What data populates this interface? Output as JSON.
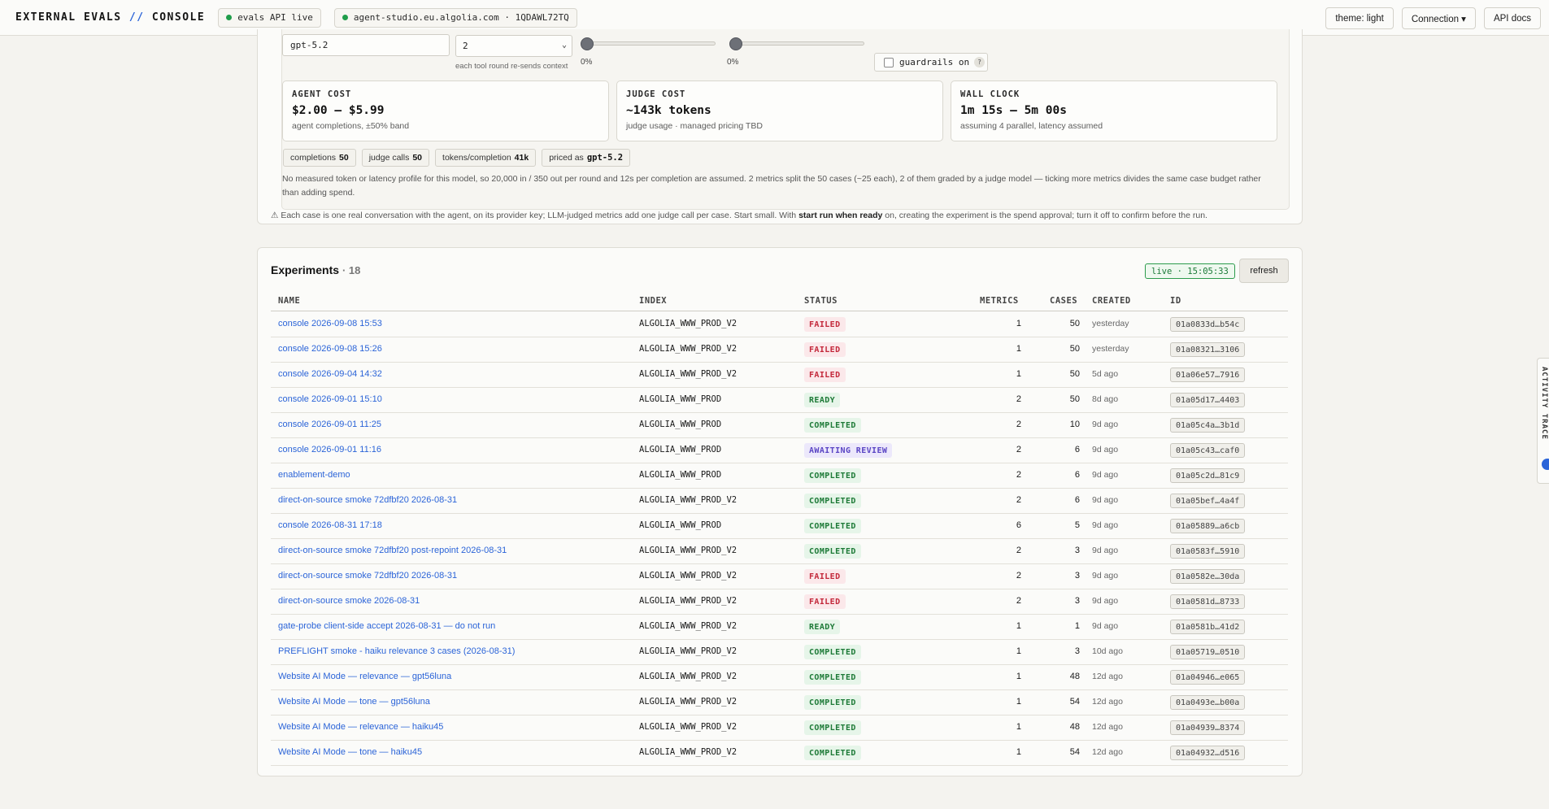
{
  "topbar": {
    "brand_main": "EXTERNAL EVALS",
    "brand_sep": "//",
    "brand_tail": "CONSOLE",
    "status_chip": "evals API live",
    "app_chip": "agent-studio.eu.algolia.com · 1QDAWL72TQ",
    "theme_button": "theme: light",
    "connection_button": "Connection ▾",
    "api_docs_button": "API docs",
    "status_color": "#1f9d4a"
  },
  "config": {
    "model_value": "gpt-5.2",
    "rounds_value": "2",
    "rounds_hint": "each tool round re-sends context",
    "slider1_pct": "0%",
    "slider1_value": 0,
    "slider2_pct": "0%",
    "slider2_value": 0,
    "guardrails_label": "guardrails on",
    "guardrails_help": "?",
    "guardrails_checked": false
  },
  "cards": [
    {
      "label": "AGENT COST",
      "value": "$2.00 – $5.99",
      "sub": "agent completions, ±50% band"
    },
    {
      "label": "JUDGE COST",
      "value": "~143k tokens",
      "sub": "judge usage · managed pricing TBD"
    },
    {
      "label": "WALL CLOCK",
      "value": "1m 15s – 5m 00s",
      "sub": "assuming 4 parallel, latency assumed"
    }
  ],
  "pills": [
    {
      "label": "completions",
      "value": "50"
    },
    {
      "label": "judge calls",
      "value": "50"
    },
    {
      "label": "tokens/completion",
      "value": "41k"
    },
    {
      "label": "priced as",
      "value": "gpt-5.2"
    }
  ],
  "note": "No measured token or latency profile for this model, so 20,000 in / 350 out per round and 12s per completion are assumed. 2 metrics split the 50 cases (~25 each), 2 of them graded by a judge model — ticking more metrics divides the same case budget rather than adding spend.",
  "warning": {
    "pre": "⚠ Each case is one real conversation with the agent, on its provider key; LLM-judged metrics add one judge call per case. Start small. With ",
    "bold": "start run when ready",
    "post": " on, creating the experiment is the spend approval; turn it off to confirm before the run."
  },
  "experiments": {
    "title": "Experiments",
    "count": "· 18",
    "live_label": "live · 15:05:33",
    "refresh_label": "refresh",
    "columns": {
      "name": "NAME",
      "index": "INDEX",
      "status": "STATUS",
      "metrics": "METRICS",
      "cases": "CASES",
      "created": "CREATED",
      "id": "ID"
    },
    "rows": [
      {
        "name": "console 2026-09-08 15:53",
        "index": "ALGOLIA_WWW_PROD_V2",
        "status": "FAILED",
        "kind": "failed",
        "metrics": "1",
        "cases": "50",
        "created": "yesterday",
        "id": "01a0833d…b54c"
      },
      {
        "name": "console 2026-09-08 15:26",
        "index": "ALGOLIA_WWW_PROD_V2",
        "status": "FAILED",
        "kind": "failed",
        "metrics": "1",
        "cases": "50",
        "created": "yesterday",
        "id": "01a08321…3106"
      },
      {
        "name": "console 2026-09-04 14:32",
        "index": "ALGOLIA_WWW_PROD_V2",
        "status": "FAILED",
        "kind": "failed",
        "metrics": "1",
        "cases": "50",
        "created": "5d ago",
        "id": "01a06e57…7916"
      },
      {
        "name": "console 2026-09-01 15:10",
        "index": "ALGOLIA_WWW_PROD",
        "status": "READY",
        "kind": "ready",
        "metrics": "2",
        "cases": "50",
        "created": "8d ago",
        "id": "01a05d17…4403"
      },
      {
        "name": "console 2026-09-01 11:25",
        "index": "ALGOLIA_WWW_PROD",
        "status": "COMPLETED",
        "kind": "completed",
        "metrics": "2",
        "cases": "10",
        "created": "9d ago",
        "id": "01a05c4a…3b1d"
      },
      {
        "name": "console 2026-09-01 11:16",
        "index": "ALGOLIA_WWW_PROD",
        "status": "AWAITING REVIEW",
        "kind": "awaiting",
        "metrics": "2",
        "cases": "6",
        "created": "9d ago",
        "id": "01a05c43…caf0"
      },
      {
        "name": "enablement-demo",
        "index": "ALGOLIA_WWW_PROD",
        "status": "COMPLETED",
        "kind": "completed",
        "metrics": "2",
        "cases": "6",
        "created": "9d ago",
        "id": "01a05c2d…81c9"
      },
      {
        "name": "direct-on-source smoke 72dfbf20 2026-08-31",
        "index": "ALGOLIA_WWW_PROD_V2",
        "status": "COMPLETED",
        "kind": "completed",
        "metrics": "2",
        "cases": "6",
        "created": "9d ago",
        "id": "01a05bef…4a4f"
      },
      {
        "name": "console 2026-08-31 17:18",
        "index": "ALGOLIA_WWW_PROD",
        "status": "COMPLETED",
        "kind": "completed",
        "metrics": "6",
        "cases": "5",
        "created": "9d ago",
        "id": "01a05889…a6cb"
      },
      {
        "name": "direct-on-source smoke 72dfbf20 post-repoint 2026-08-31",
        "index": "ALGOLIA_WWW_PROD_V2",
        "status": "COMPLETED",
        "kind": "completed",
        "metrics": "2",
        "cases": "3",
        "created": "9d ago",
        "id": "01a0583f…5910"
      },
      {
        "name": "direct-on-source smoke 72dfbf20 2026-08-31",
        "index": "ALGOLIA_WWW_PROD_V2",
        "status": "FAILED",
        "kind": "failed",
        "metrics": "2",
        "cases": "3",
        "created": "9d ago",
        "id": "01a0582e…30da"
      },
      {
        "name": "direct-on-source smoke 2026-08-31",
        "index": "ALGOLIA_WWW_PROD_V2",
        "status": "FAILED",
        "kind": "failed",
        "metrics": "2",
        "cases": "3",
        "created": "9d ago",
        "id": "01a0581d…8733"
      },
      {
        "name": "gate-probe client-side accept 2026-08-31 — do not run",
        "index": "ALGOLIA_WWW_PROD_V2",
        "status": "READY",
        "kind": "ready",
        "metrics": "1",
        "cases": "1",
        "created": "9d ago",
        "id": "01a0581b…41d2"
      },
      {
        "name": "PREFLIGHT smoke - haiku relevance 3 cases (2026-08-31)",
        "index": "ALGOLIA_WWW_PROD_V2",
        "status": "COMPLETED",
        "kind": "completed",
        "metrics": "1",
        "cases": "3",
        "created": "10d ago",
        "id": "01a05719…0510"
      },
      {
        "name": "Website AI Mode — relevance — gpt56luna",
        "index": "ALGOLIA_WWW_PROD_V2",
        "status": "COMPLETED",
        "kind": "completed",
        "metrics": "1",
        "cases": "48",
        "created": "12d ago",
        "id": "01a04946…e065"
      },
      {
        "name": "Website AI Mode — tone — gpt56luna",
        "index": "ALGOLIA_WWW_PROD_V2",
        "status": "COMPLETED",
        "kind": "completed",
        "metrics": "1",
        "cases": "54",
        "created": "12d ago",
        "id": "01a0493e…b00a"
      },
      {
        "name": "Website AI Mode — relevance — haiku45",
        "index": "ALGOLIA_WWW_PROD_V2",
        "status": "COMPLETED",
        "kind": "completed",
        "metrics": "1",
        "cases": "48",
        "created": "12d ago",
        "id": "01a04939…8374"
      },
      {
        "name": "Website AI Mode — tone — haiku45",
        "index": "ALGOLIA_WWW_PROD_V2",
        "status": "COMPLETED",
        "kind": "completed",
        "metrics": "1",
        "cases": "54",
        "created": "12d ago",
        "id": "01a04932…d516"
      }
    ]
  },
  "side_tab": {
    "label": "ACTIVITY TRACE"
  }
}
